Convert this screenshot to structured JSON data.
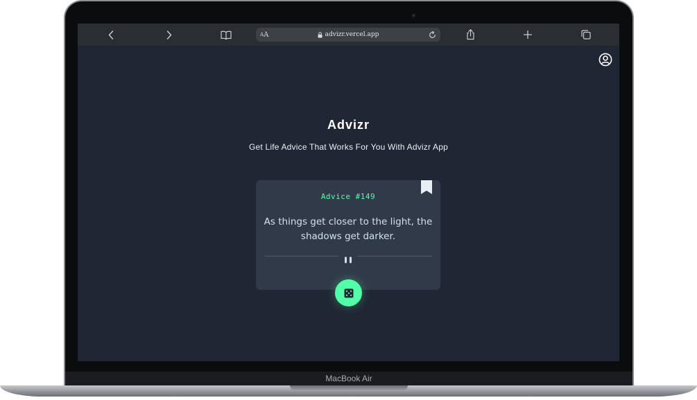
{
  "device": {
    "brand_label": "MacBook Air"
  },
  "browser": {
    "text_size_label_small": "A",
    "text_size_label_big": "A",
    "url": "advizr.vercel.app"
  },
  "app": {
    "title": "Advizr",
    "subtitle": "Get Life Advice That Works For You With Advizr App",
    "advice_label": "Advice #149",
    "advice_text": "As things get closer to the light, the shadows get darker."
  },
  "colors": {
    "page_background": "#202633",
    "card_background": "#313a48",
    "accent": "#52ffa8",
    "quote_text": "#cee3e9",
    "divider": "#4f5d74"
  },
  "icons": {
    "toolbar": [
      "chevron-left-icon",
      "chevron-right-icon",
      "book-icon",
      "lock-icon",
      "reload-icon",
      "share-icon",
      "plus-icon",
      "tabs-icon"
    ],
    "page": [
      "user-circle-icon",
      "bookmark-icon",
      "pause-icon",
      "dice-icon"
    ]
  }
}
